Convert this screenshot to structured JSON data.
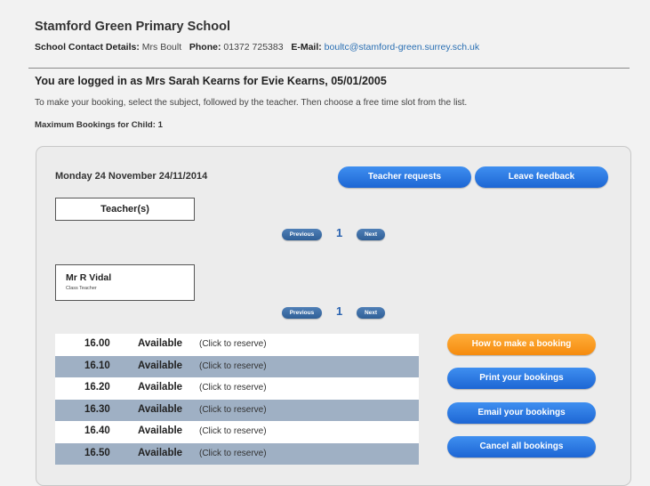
{
  "header": {
    "school_name": "Stamford Green Primary School",
    "contact_label": "School Contact Details:",
    "contact_name": "Mrs Boult",
    "phone_label": "Phone:",
    "phone": "01372 725383",
    "email_label": "E-Mail:",
    "email": "boultc@stamford-green.surrey.sch.uk"
  },
  "session": {
    "logged_in_text": "You are logged in as Mrs Sarah Kearns for Evie Kearns, 05/01/2005",
    "instructions": "To make your booking, select the subject, followed by the teacher. Then choose a free time slot from the list.",
    "max_bookings": "Maximum Bookings for Child: 1"
  },
  "booking": {
    "date": "Monday 24 November 24/11/2014",
    "teacher_requests_label": "Teacher requests",
    "leave_feedback_label": "Leave feedback",
    "teachers_header": "Teacher(s)",
    "pager_top": {
      "previous": "Previous",
      "page": "1",
      "next": "Next"
    },
    "pager_bottom": {
      "previous": "Previous",
      "page": "1",
      "next": "Next"
    },
    "teacher": {
      "name": "Mr R Vidal",
      "role": "Class Teacher"
    },
    "slots": [
      {
        "time": "16.00",
        "status": "Available",
        "action": "(Click to reserve)"
      },
      {
        "time": "16.10",
        "status": "Available",
        "action": "(Click to reserve)"
      },
      {
        "time": "16.20",
        "status": "Available",
        "action": "(Click to reserve)"
      },
      {
        "time": "16.30",
        "status": "Available",
        "action": "(Click to reserve)"
      },
      {
        "time": "16.40",
        "status": "Available",
        "action": "(Click to reserve)"
      },
      {
        "time": "16.50",
        "status": "Available",
        "action": "(Click to reserve)"
      }
    ],
    "side_buttons": {
      "how_to": "How to make a booking",
      "print": "Print your bookings",
      "email": "Email your bookings",
      "cancel": "Cancel all bookings"
    }
  },
  "colors": {
    "button_blue": "#2f7be6",
    "button_orange": "#f8991f",
    "row_alt": "#9fb0c4",
    "email_link": "#2a6fb3"
  }
}
